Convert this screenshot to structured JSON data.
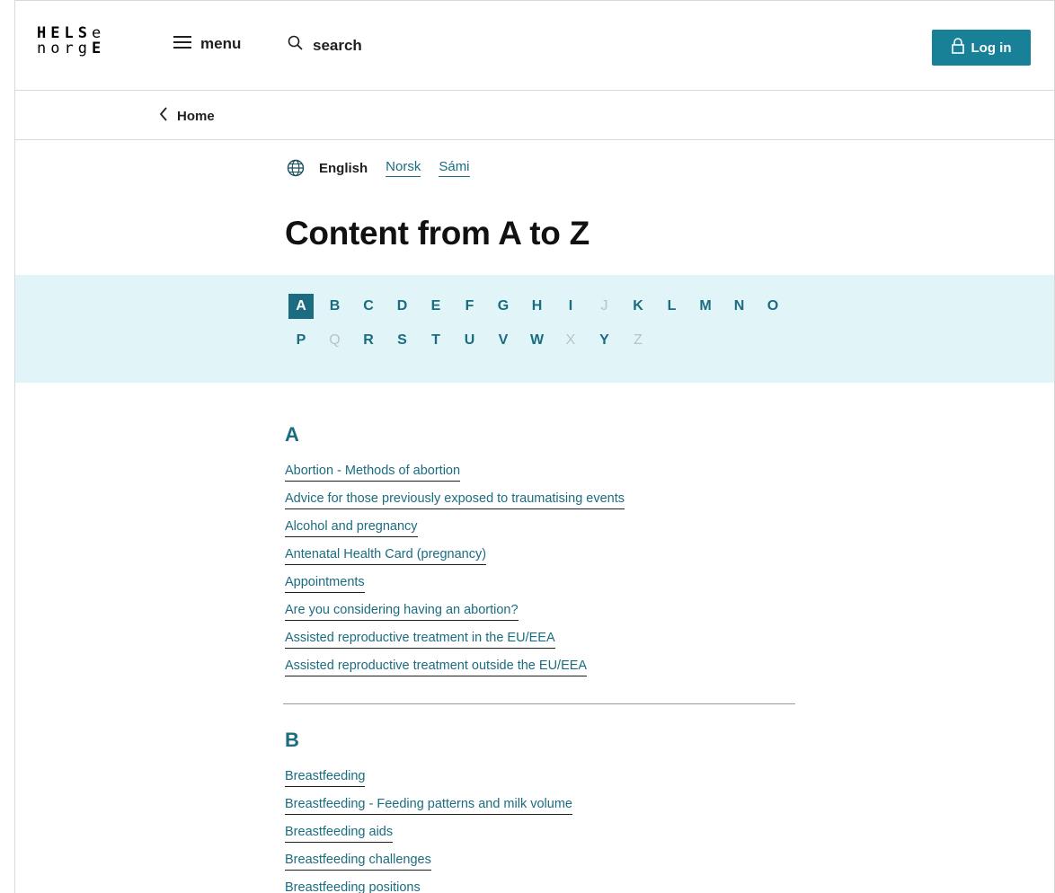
{
  "header": {
    "logo_line1_regular_a": "HELS",
    "logo_line1_regular_b": "e",
    "logo_line2_regular": "norg",
    "logo_line2_bold": "E",
    "menu_label": "menu",
    "search_label": "search",
    "login_label": "Log in"
  },
  "breadcrumb": {
    "home_label": "Home"
  },
  "languages": {
    "current": "English",
    "others": [
      "Norsk",
      "Sámi"
    ]
  },
  "page_title": "Content from A to Z",
  "alphabet": {
    "active": "A",
    "letters": [
      {
        "l": "A",
        "enabled": true
      },
      {
        "l": "B",
        "enabled": true
      },
      {
        "l": "C",
        "enabled": true
      },
      {
        "l": "D",
        "enabled": true
      },
      {
        "l": "E",
        "enabled": true
      },
      {
        "l": "F",
        "enabled": true
      },
      {
        "l": "G",
        "enabled": true
      },
      {
        "l": "H",
        "enabled": true
      },
      {
        "l": "I",
        "enabled": true
      },
      {
        "l": "J",
        "enabled": false
      },
      {
        "l": "K",
        "enabled": true
      },
      {
        "l": "L",
        "enabled": true
      },
      {
        "l": "M",
        "enabled": true
      },
      {
        "l": "N",
        "enabled": true
      },
      {
        "l": "O",
        "enabled": true
      },
      {
        "l": "P",
        "enabled": true
      },
      {
        "l": "Q",
        "enabled": false
      },
      {
        "l": "R",
        "enabled": true
      },
      {
        "l": "S",
        "enabled": true
      },
      {
        "l": "T",
        "enabled": true
      },
      {
        "l": "U",
        "enabled": true
      },
      {
        "l": "V",
        "enabled": true
      },
      {
        "l": "W",
        "enabled": true
      },
      {
        "l": "X",
        "enabled": false
      },
      {
        "l": "Y",
        "enabled": true
      },
      {
        "l": "Z",
        "enabled": false
      }
    ]
  },
  "sections": [
    {
      "letter": "A",
      "links": [
        "Abortion - Methods of abortion",
        "Advice for those previously exposed to traumatising events",
        "Alcohol and pregnancy",
        "Antenatal Health Card (pregnancy)",
        "Appointments",
        "Are you considering having an abortion?",
        "Assisted reproductive treatment in the EU/EEA",
        "Assisted reproductive treatment outside the EU/EEA"
      ]
    },
    {
      "letter": "B",
      "links": [
        "Breastfeeding",
        "Breastfeeding - Feeding patterns and milk volume",
        "Breastfeeding aids",
        "Breastfeeding challenges",
        "Breastfeeding positions"
      ]
    }
  ],
  "colors": {
    "accent": "#1b6c80",
    "login_button": "#188097",
    "alphabet_band": "#e1f5f8",
    "disabled_letter": "#b8c3c6"
  },
  "icons": {
    "menu": "hamburger-icon",
    "search": "magnifier-icon",
    "login": "lock-icon",
    "back": "chevron-left-icon",
    "language": "globe-icon"
  }
}
